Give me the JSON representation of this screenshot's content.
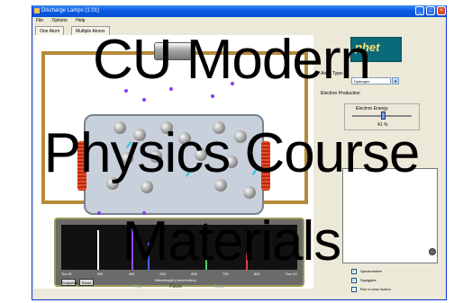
{
  "window": {
    "title": "Discharge Lamps (1.01)",
    "controls": [
      "_",
      "□",
      "×"
    ]
  },
  "menu": [
    "File",
    "Options",
    "Help"
  ],
  "tabs": [
    "One Atom",
    "Multiple Atoms"
  ],
  "spectrometer": {
    "axis_labels": [
      "Too IR",
      "300",
      "400",
      "500",
      "600",
      "700",
      "800",
      "Too UV"
    ],
    "caption": "Wavelength (nanometers)",
    "buttons": [
      "Snapshot",
      "Reset"
    ]
  },
  "playback": [
    "Play",
    "Pause",
    "Step"
  ],
  "panel": {
    "logo_text": "phet",
    "atom_type_label": "Atom Type:",
    "atom_type_value": "Hydrogen",
    "electron_production_label": "Electron Production",
    "electron_energy_label": "Electron Energy",
    "slider_percent": "41 %",
    "checkboxes": [
      {
        "label": "Spectrometer",
        "checked": true
      },
      {
        "label": "Squiggles",
        "checked": true
      },
      {
        "label": "Run in slow motion",
        "checked": false
      }
    ]
  },
  "overlay_caption": {
    "lines": [
      "CU Modern",
      "Physics Course",
      "Materials"
    ]
  },
  "colors": {
    "titlebar": "#0553d6",
    "wire": "#b58a3a",
    "electron": "#8a3cf0",
    "photon": "#25c7d8"
  }
}
